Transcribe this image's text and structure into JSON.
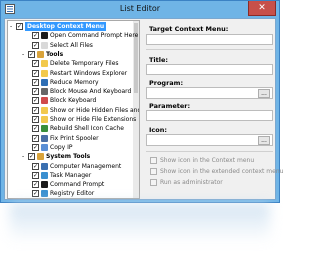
{
  "window": {
    "title": "List Editor",
    "close_glyph": "✕",
    "app_icon": "list-editor-icon"
  },
  "tree": {
    "items": [
      {
        "label": "Desktop Context Menu",
        "kind": "section",
        "selected": true,
        "expander": "-",
        "icon_color": ""
      },
      {
        "label": "Open Command Prompt Here",
        "kind": "item",
        "icon_color": "#1b1b1b"
      },
      {
        "label": "Select All Files",
        "kind": "item",
        "icon_color": "#d9d9d9"
      },
      {
        "label": "Tools",
        "kind": "section",
        "expander": "-",
        "icon_color": "#d9a33b"
      },
      {
        "label": "Delete Temporary Files",
        "kind": "item",
        "icon_color": "#f2c94c"
      },
      {
        "label": "Restart Windows Explorer",
        "kind": "item",
        "icon_color": "#f2c94c"
      },
      {
        "label": "Reduce Memory",
        "kind": "item",
        "icon_color": "#2f6fb5"
      },
      {
        "label": "Block Mouse And Keyboard",
        "kind": "item",
        "icon_color": "#666666"
      },
      {
        "label": "Block Keyboard",
        "kind": "item",
        "icon_color": "#d04a4a"
      },
      {
        "label": "Show or Hide Hidden Files and",
        "kind": "item",
        "icon_color": "#f2c94c"
      },
      {
        "label": "Show or Hide File Extensions",
        "kind": "item",
        "icon_color": "#f2c94c"
      },
      {
        "label": "Rebuild Shell Icon Cache",
        "kind": "item",
        "icon_color": "#3a8f3a"
      },
      {
        "label": "Fix Print Spooler",
        "kind": "item",
        "icon_color": "#4a6fa5"
      },
      {
        "label": "Copy IP",
        "kind": "item",
        "icon_color": "#5a8fd6"
      },
      {
        "label": "System Tools",
        "kind": "section",
        "expander": "-",
        "icon_color": "#d9a33b"
      },
      {
        "label": "Computer Management",
        "kind": "item",
        "icon_color": "#3a6fb0"
      },
      {
        "label": "Task Manager",
        "kind": "item",
        "icon_color": "#3a8fd0"
      },
      {
        "label": "Command Prompt",
        "kind": "item",
        "icon_color": "#1b1b1b"
      },
      {
        "label": "Registry Editor",
        "kind": "item",
        "icon_color": "#3a8fd0"
      }
    ]
  },
  "form": {
    "target_label": "Target Context Menu:",
    "title_label": "Title:",
    "program_label": "Program:",
    "parameter_label": "Parameter:",
    "icon_label": "Icon:",
    "browse_label": "...",
    "options": [
      "Show icon in the Context menu",
      "Show icon in the extended context menu",
      "Run as administrator"
    ]
  }
}
